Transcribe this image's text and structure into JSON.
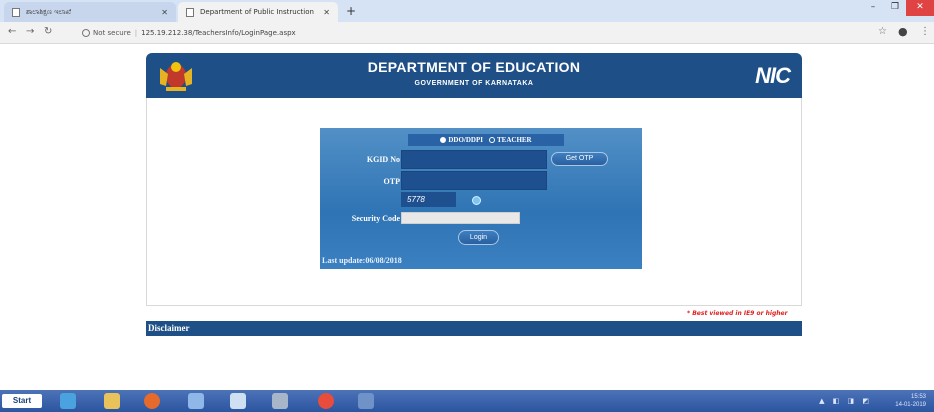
{
  "browser": {
    "tabs": [
      {
        "title": "ಶಾಲಾಶಿಕ್ಷಣ ಇಲಾಖೆ"
      },
      {
        "title": "Department of Public Instruction"
      }
    ],
    "tab_close": "✕",
    "new_tab": "+",
    "security_label": "Not secure",
    "url": "125.19.212.38/TeachersInfo/LoginPage.aspx"
  },
  "header": {
    "title": "DEPARTMENT OF EDUCATION",
    "subtitle": "GOVERNMENT OF KARNATAKA",
    "logo_text": "NIC"
  },
  "login": {
    "roles": [
      {
        "label": "DDO/DDPI",
        "selected": true
      },
      {
        "label": "TEACHER",
        "selected": false
      }
    ],
    "kgid_label": "KGID No",
    "kgid_value": "",
    "otp_label": "OTP",
    "otp_value": "",
    "get_otp_label": "Get OTP",
    "captcha_text": "5778",
    "security_label": "Security Code",
    "security_value": "",
    "login_label": "Login",
    "last_update": "Last update:06/08/2018"
  },
  "notes": {
    "best_viewed": "* Best viewed in IE9 or higher",
    "disclaimer": "Disclaimer"
  },
  "taskbar": {
    "start_label": "Start",
    "time": "15:53",
    "date": "14-01-2019"
  },
  "colors": {
    "header_bg": "#1f4f87",
    "panel_bg": "#2f74b5",
    "warning": "#e02020"
  }
}
